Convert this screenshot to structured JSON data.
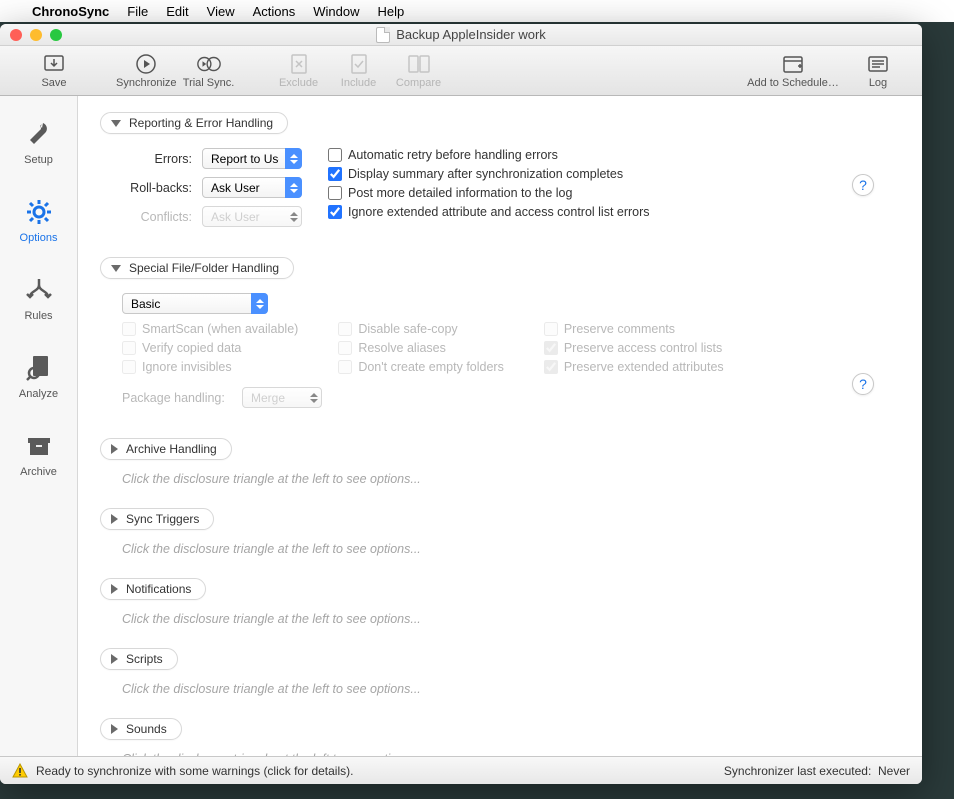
{
  "menubar": {
    "apple": "",
    "app": "ChronoSync",
    "items": [
      "File",
      "Edit",
      "View",
      "Actions",
      "Window",
      "Help"
    ]
  },
  "window": {
    "title": "Backup AppleInsider work"
  },
  "toolbar": {
    "save": "Save",
    "sync": "Synchronize",
    "trial": "Trial Sync.",
    "exclude": "Exclude",
    "include": "Include",
    "compare": "Compare",
    "schedule": "Add to Schedule…",
    "log": "Log"
  },
  "sidebar": {
    "setup": "Setup",
    "options": "Options",
    "rules": "Rules",
    "analyze": "Analyze",
    "archive": "Archive"
  },
  "sections": {
    "reporting": {
      "title": "Reporting & Error Handling",
      "errors_lbl": "Errors:",
      "errors_val": "Report to User",
      "rollbacks_lbl": "Roll-backs:",
      "rollbacks_val": "Ask User",
      "conflicts_lbl": "Conflicts:",
      "conflicts_val": "Ask User",
      "chk_retry": "Automatic retry before handling errors",
      "chk_summary": "Display summary after synchronization completes",
      "chk_postlog": "Post more detailed information to the log",
      "chk_ignoreattr": "Ignore extended attribute and access control list errors"
    },
    "special": {
      "title": "Special File/Folder Handling",
      "mode": "Basic",
      "smartscan": "SmartScan (when available)",
      "verify": "Verify copied data",
      "ignoreinv": "Ignore invisibles",
      "disablesafe": "Disable safe-copy",
      "resolvealias": "Resolve aliases",
      "dontempty": "Don't create empty folders",
      "prescomments": "Preserve comments",
      "presacl": "Preserve access control lists",
      "presextattr": "Preserve extended attributes",
      "pkg_lbl": "Package handling:",
      "pkg_val": "Merge"
    },
    "archive": {
      "title": "Archive Handling",
      "hint": "Click the disclosure triangle at the left to see options..."
    },
    "synctrig": {
      "title": "Sync Triggers",
      "hint": "Click the disclosure triangle at the left to see options..."
    },
    "notif": {
      "title": "Notifications",
      "hint": "Click the disclosure triangle at the left to see options..."
    },
    "scripts": {
      "title": "Scripts",
      "hint": "Click the disclosure triangle at the left to see options..."
    },
    "sounds": {
      "title": "Sounds",
      "hint": "Click the disclosure triangle at the left to see options..."
    }
  },
  "status": {
    "left": "Ready to synchronize with some warnings (click for details).",
    "right_lbl": "Synchronizer last executed:",
    "right_val": "Never"
  },
  "help": "?"
}
